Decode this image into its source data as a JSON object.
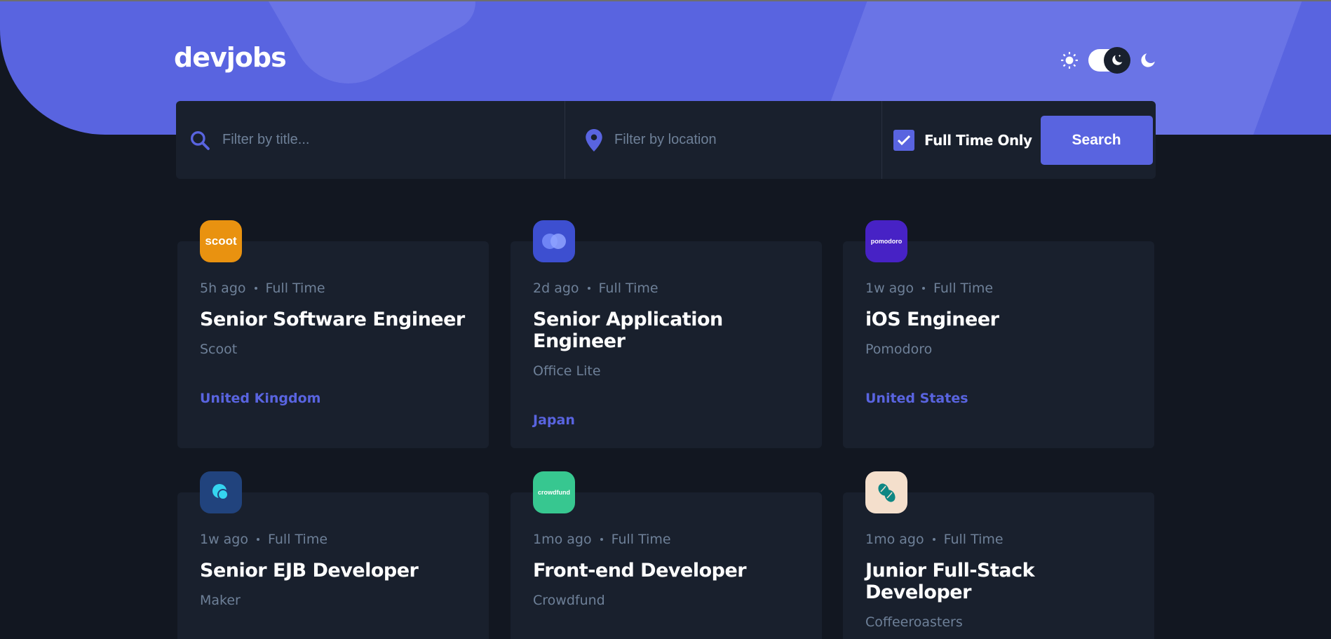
{
  "header": {
    "logo": "devjobs",
    "theme_icons": [
      "sun-icon",
      "moon-icon"
    ]
  },
  "search": {
    "title_placeholder": "Filter by title...",
    "location_placeholder": "Filter by location",
    "fulltime_label": "Full Time Only",
    "fulltime_checked": true,
    "button_label": "Search"
  },
  "colors": {
    "accent": "#5964e0",
    "background": "#121721",
    "card": "#19202d",
    "muted": "#6e8098"
  },
  "jobs": [
    {
      "posted": "5h ago",
      "contract": "Full Time",
      "position": "Senior Software Engineer",
      "company": "Scoot",
      "location": "United Kingdom",
      "logo_text": "scoot",
      "logo_bg": "#e99210"
    },
    {
      "posted": "2d ago",
      "contract": "Full Time",
      "position": "Senior Application Engineer",
      "company": "Office Lite",
      "location": "Japan",
      "logo_text": "",
      "logo_bg": "#4e2ad4"
    },
    {
      "posted": "1w ago",
      "contract": "Full Time",
      "position": "iOS Engineer",
      "company": "Pomodoro",
      "location": "United States",
      "logo_text": "pomodoro",
      "logo_bg": "#4722c5"
    },
    {
      "posted": "1w ago",
      "contract": "Full Time",
      "position": "Senior EJB Developer",
      "company": "Maker",
      "location": "",
      "logo_text": "",
      "logo_bg": "#21437d"
    },
    {
      "posted": "1mo ago",
      "contract": "Full Time",
      "position": "Front-end Developer",
      "company": "Crowdfund",
      "location": "",
      "logo_text": "crowdfund",
      "logo_bg": "#37c790"
    },
    {
      "posted": "1mo ago",
      "contract": "Full Time",
      "position": "Junior Full-Stack Developer",
      "company": "Coffeeroasters",
      "location": "",
      "logo_text": "",
      "logo_bg": "#f4dfcc"
    }
  ]
}
